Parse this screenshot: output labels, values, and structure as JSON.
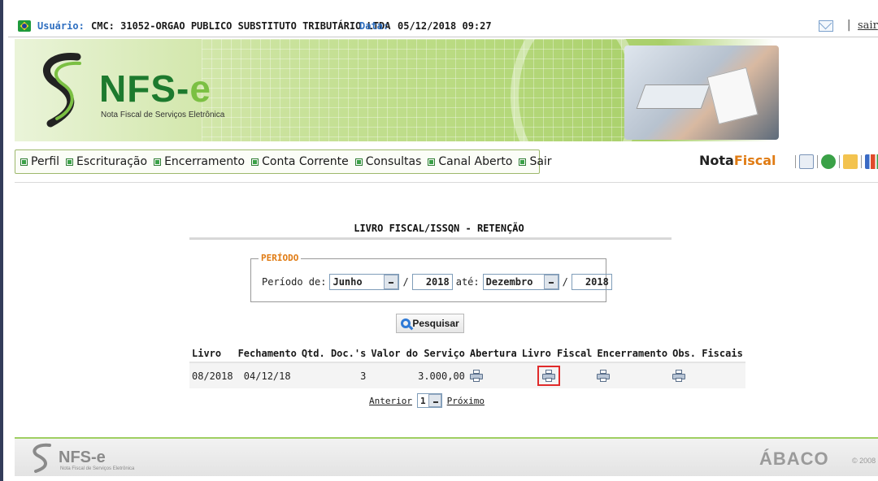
{
  "topbar": {
    "user_label": "Usuário:",
    "user_value": "CMC: 31052-ORGAO PUBLICO SUBSTITUTO TRIBUTÁRIO LTDA",
    "date_label": "Data:",
    "date_value": "05/12/2018 09:27",
    "pipe": "|",
    "logout": "sair",
    "icons": [
      "brazil-flag-icon",
      "mail-icon"
    ]
  },
  "banner": {
    "logo_nfs": "NFS",
    "logo_dash": "-",
    "logo_e": "e",
    "subtitle": "Nota Fiscal de Serviços Eletrônica"
  },
  "nav": {
    "items": [
      {
        "label": "Perfil"
      },
      {
        "label": "Escrituração"
      },
      {
        "label": "Encerramento"
      },
      {
        "label": "Conta Corrente"
      },
      {
        "label": "Consultas"
      },
      {
        "label": "Canal Aberto"
      },
      {
        "label": "Sair"
      }
    ]
  },
  "brand": {
    "nota": "Nota",
    "fiscal": "Fiscal",
    "icons": [
      "document-icon",
      "refresh-icon",
      "home-icon",
      "chart-icon"
    ]
  },
  "main": {
    "title": "LIVRO FISCAL/ISSQN - RETENÇÃO",
    "periodo": {
      "legend": "PERÍODO",
      "from_label": "Período de:",
      "from_month": "Junho",
      "slash1": "/",
      "from_year": "2018",
      "until_label": "até:",
      "to_month": "Dezembro",
      "slash2": "/",
      "to_year": "2018"
    },
    "search_button": "Pesquisar",
    "table": {
      "headers": [
        "Livro",
        "Fechamento",
        "Qtd. Doc.'s",
        "Valor do Serviço",
        "Abertura",
        "Livro Fiscal",
        "Encerramento",
        "Obs. Fiscais"
      ],
      "rows": [
        {
          "livro": "08/2018",
          "fechamento": "04/12/18",
          "qtd": "3",
          "valor": "3.000,00"
        }
      ]
    },
    "pager": {
      "prev": "Anterior",
      "page": "1",
      "next": "Próximo"
    }
  },
  "footer": {
    "logo_nfs": "NFS",
    "logo_dash": "-",
    "logo_e": "e",
    "subtitle": "Nota Fiscal de Serviços Eletrônica",
    "vendor": "ÁBACO",
    "copyright": "© 2008"
  },
  "colors": {
    "brand_green": "#1d7a2e",
    "accent_orange": "#e07b13",
    "link_blue": "#2f6fc0",
    "highlight_red": "#e02b2b"
  }
}
